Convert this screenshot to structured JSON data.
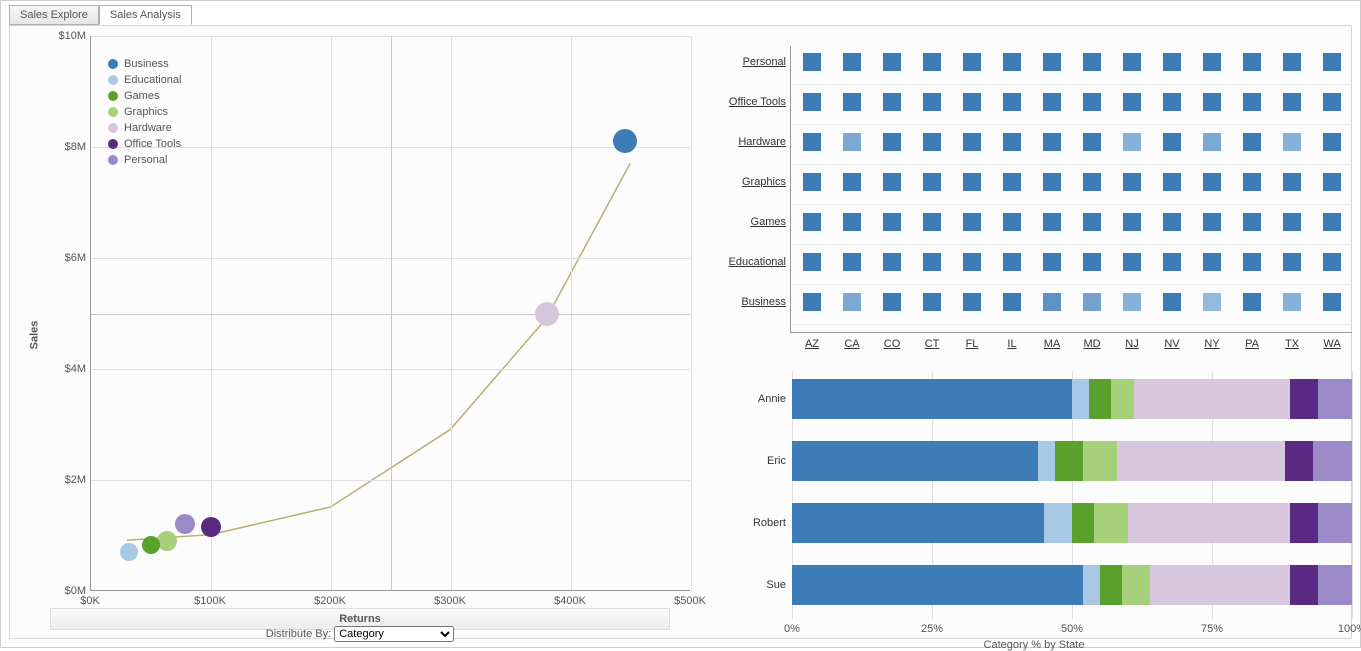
{
  "tabs": {
    "explore": "Sales Explore",
    "analysis": "Sales Analysis"
  },
  "distribute": {
    "label": "Distribute By:",
    "selected": "Category"
  },
  "legend_items": [
    {
      "name": "Business",
      "color": "#3d7cb6"
    },
    {
      "name": "Educational",
      "color": "#a8c8e6"
    },
    {
      "name": "Games",
      "color": "#5aa02c"
    },
    {
      "name": "Graphics",
      "color": "#a6d07a"
    },
    {
      "name": "Hardware",
      "color": "#d8c6dc"
    },
    {
      "name": "Office Tools",
      "color": "#5a2a82"
    },
    {
      "name": "Personal",
      "color": "#9a8ac8"
    }
  ],
  "chart_data": [
    {
      "id": "scatter",
      "type": "scatter",
      "title": "",
      "xlabel": "Returns",
      "ylabel": "Sales",
      "xlim": [
        0,
        500000
      ],
      "ylim": [
        0,
        10000000
      ],
      "xticks": [
        "$0K",
        "$100K",
        "$200K",
        "$300K",
        "$400K",
        "$500K"
      ],
      "yticks": [
        "$0M",
        "$2M",
        "$4M",
        "$6M",
        "$8M",
        "$10M"
      ],
      "quadrant_x": 250000,
      "quadrant_y": 5000000,
      "trend": [
        [
          30000,
          900000
        ],
        [
          100000,
          1000000
        ],
        [
          200000,
          1500000
        ],
        [
          300000,
          2900000
        ],
        [
          380000,
          4900000
        ],
        [
          450000,
          7700000
        ]
      ],
      "points": [
        {
          "cat": "Business",
          "x": 445000,
          "y": 8100000,
          "r": 12,
          "color": "#3d7cb6"
        },
        {
          "cat": "Hardware",
          "x": 380000,
          "y": 5000000,
          "r": 12,
          "color": "#d8c6dc"
        },
        {
          "cat": "Office Tools",
          "x": 100000,
          "y": 1150000,
          "r": 10,
          "color": "#5a2a82"
        },
        {
          "cat": "Personal",
          "x": 78000,
          "y": 1200000,
          "r": 10,
          "color": "#9a8ac8"
        },
        {
          "cat": "Graphics",
          "x": 63000,
          "y": 900000,
          "r": 10,
          "color": "#a6d07a"
        },
        {
          "cat": "Games",
          "x": 50000,
          "y": 820000,
          "r": 9,
          "color": "#5aa02c"
        },
        {
          "cat": "Educational",
          "x": 32000,
          "y": 700000,
          "r": 9,
          "color": "#a8c8e6"
        }
      ]
    },
    {
      "id": "heatmap",
      "type": "heatmap",
      "rows": [
        "Personal",
        "Office Tools",
        "Hardware",
        "Graphics",
        "Games",
        "Educational",
        "Business"
      ],
      "cols": [
        "AZ",
        "CA",
        "CO",
        "CT",
        "FL",
        "IL",
        "MA",
        "MD",
        "NJ",
        "NV",
        "NY",
        "PA",
        "TX",
        "WA"
      ],
      "palette_low": "#a8c8e6",
      "palette_high": "#3d7cb6",
      "values": [
        [
          1,
          1,
          1,
          1,
          1,
          1,
          1,
          1,
          1,
          1,
          1,
          1,
          1,
          1
        ],
        [
          1,
          1,
          1,
          1,
          1,
          1,
          1,
          1,
          1,
          1,
          1,
          1,
          1,
          1
        ],
        [
          1,
          0.4,
          1,
          1,
          1,
          1,
          1,
          1,
          0.3,
          1,
          0.4,
          1,
          0.3,
          1
        ],
        [
          1,
          1,
          1,
          1,
          1,
          1,
          1,
          1,
          1,
          1,
          1,
          1,
          1,
          1
        ],
        [
          1,
          1,
          1,
          1,
          1,
          1,
          1,
          1,
          1,
          1,
          1,
          1,
          1,
          1
        ],
        [
          1,
          1,
          1,
          1,
          1,
          1,
          1,
          1,
          1,
          1,
          1,
          1,
          1,
          1
        ],
        [
          1,
          0.4,
          1,
          1,
          1,
          1,
          0.7,
          0.5,
          0.3,
          1,
          0.2,
          1,
          0.3,
          1
        ]
      ]
    },
    {
      "id": "stacked",
      "type": "bar",
      "orientation": "horizontal_stacked",
      "xlabel": "Category % by State",
      "xticks": [
        "0%",
        "25%",
        "50%",
        "75%",
        "100%"
      ],
      "categories": [
        "Annie",
        "Eric",
        "Robert",
        "Sue"
      ],
      "series_order": [
        "Business",
        "Educational",
        "Games",
        "Graphics",
        "Hardware",
        "Office Tools",
        "Personal"
      ],
      "colors": {
        "Business": "#3d7cb6",
        "Educational": "#a8c8e6",
        "Games": "#5aa02c",
        "Graphics": "#a6d07a",
        "Hardware": "#d8c6dc",
        "Office Tools": "#5a2a82",
        "Personal": "#9a8ac8"
      },
      "values": {
        "Annie": {
          "Business": 50,
          "Educational": 3,
          "Games": 4,
          "Graphics": 4,
          "Hardware": 28,
          "Office Tools": 5,
          "Personal": 6
        },
        "Eric": {
          "Business": 44,
          "Educational": 3,
          "Games": 5,
          "Graphics": 6,
          "Hardware": 30,
          "Office Tools": 5,
          "Personal": 7
        },
        "Robert": {
          "Business": 45,
          "Educational": 5,
          "Games": 4,
          "Graphics": 6,
          "Hardware": 29,
          "Office Tools": 5,
          "Personal": 6
        },
        "Sue": {
          "Business": 52,
          "Educational": 3,
          "Games": 4,
          "Graphics": 5,
          "Hardware": 25,
          "Office Tools": 5,
          "Personal": 6
        }
      }
    }
  ]
}
